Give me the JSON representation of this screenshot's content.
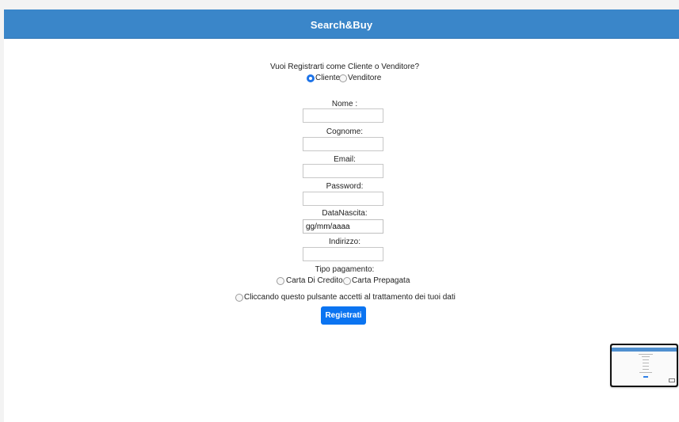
{
  "brand": {
    "title": "Search&Buy"
  },
  "form": {
    "question": "Vuoi Registrarti come Cliente o Venditore?",
    "user_type": {
      "options": [
        "Cliente",
        "Venditore"
      ],
      "selected": "Cliente"
    },
    "fields": {
      "nome": "Nome :",
      "cognome": "Cognome:",
      "email": "Email:",
      "password": "Password:",
      "data_nascita": "DataNascita:",
      "data_placeholder": "gg/mm/aaaa",
      "indirizzo": "Indirizzo:"
    },
    "payment": {
      "label": "Tipo pagamento:",
      "options": [
        "Carta Di Credito",
        "Carta Prepagata"
      ]
    },
    "consent": "Cliccando questo pulsante accetti al trattamento dei tuoi dati",
    "submit": "Registrati"
  },
  "colors": {
    "navbar": "#3a86c9",
    "primary_button": "#0b74f1",
    "radio_checked": "#1d73e8"
  }
}
